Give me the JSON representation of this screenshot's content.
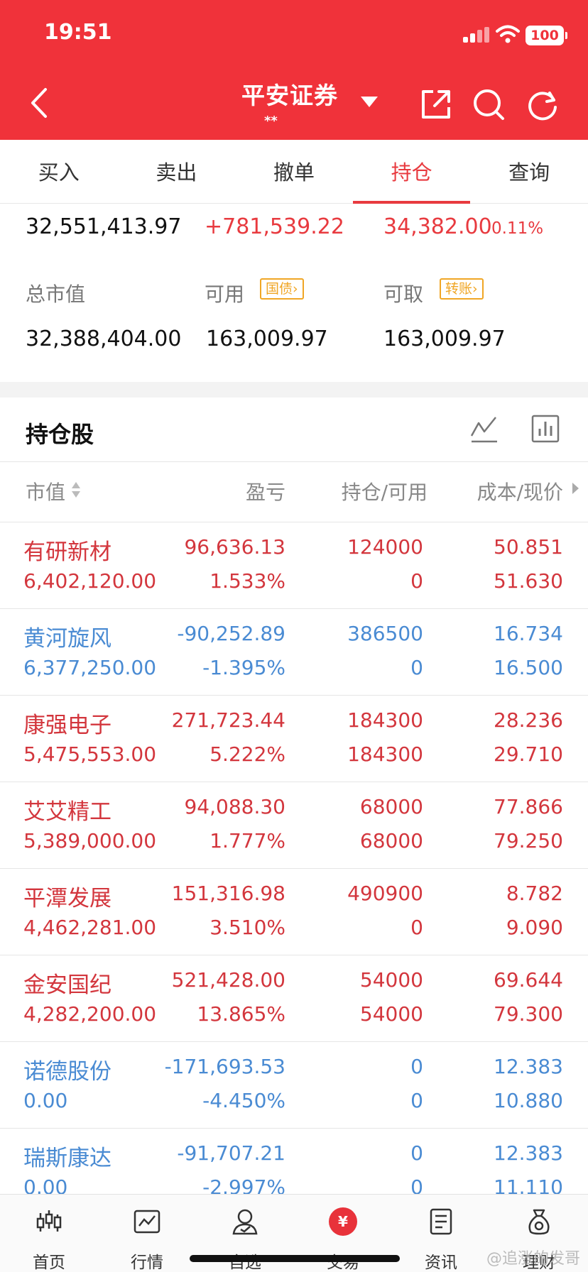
{
  "status": {
    "time": "19:51",
    "battery": "100"
  },
  "header": {
    "title": "平安证券",
    "subtitle": "**"
  },
  "tabs": [
    "买入",
    "卖出",
    "撤单",
    "持仓",
    "查询"
  ],
  "summary": {
    "total_asset": "32,551,413.97",
    "floating_pl": "+781,539.22",
    "today_pl": "34,382.00",
    "today_pl_pct": "0.11%",
    "market_value_label": "总市值",
    "market_value": "32,388,404.00",
    "available_label": "可用",
    "available_tag": "国债",
    "available": "163,009.97",
    "withdrawable_label": "可取",
    "withdrawable_tag": "转账",
    "withdrawable": "163,009.97"
  },
  "holdings": {
    "title": "持仓股",
    "columns": {
      "market_value": "市值",
      "pl": "盈亏",
      "position": "持仓/可用",
      "cost_price": "成本/现价"
    },
    "rows": [
      {
        "name": "有研新材",
        "market_value": "6,402,120.00",
        "pl": "96,636.13",
        "pl_pct": "1.533%",
        "position": "124000",
        "available": "0",
        "cost": "50.851",
        "price": "51.630",
        "trend": "up"
      },
      {
        "name": "黄河旋风",
        "market_value": "6,377,250.00",
        "pl": "-90,252.89",
        "pl_pct": "-1.395%",
        "position": "386500",
        "available": "0",
        "cost": "16.734",
        "price": "16.500",
        "trend": "down"
      },
      {
        "name": "康强电子",
        "market_value": "5,475,553.00",
        "pl": "271,723.44",
        "pl_pct": "5.222%",
        "position": "184300",
        "available": "184300",
        "cost": "28.236",
        "price": "29.710",
        "trend": "up"
      },
      {
        "name": "艾艾精工",
        "market_value": "5,389,000.00",
        "pl": "94,088.30",
        "pl_pct": "1.777%",
        "position": "68000",
        "available": "68000",
        "cost": "77.866",
        "price": "79.250",
        "trend": "up"
      },
      {
        "name": "平潭发展",
        "market_value": "4,462,281.00",
        "pl": "151,316.98",
        "pl_pct": "3.510%",
        "position": "490900",
        "available": "0",
        "cost": "8.782",
        "price": "9.090",
        "trend": "up"
      },
      {
        "name": "金安国纪",
        "market_value": "4,282,200.00",
        "pl": "521,428.00",
        "pl_pct": "13.865%",
        "position": "54000",
        "available": "54000",
        "cost": "69.644",
        "price": "79.300",
        "trend": "up"
      },
      {
        "name": "诺德股份",
        "market_value": "0.00",
        "pl": "-171,693.53",
        "pl_pct": "-4.450%",
        "position": "0",
        "available": "0",
        "cost": "12.383",
        "price": "10.880",
        "trend": "down"
      },
      {
        "name": "瑞斯康达",
        "market_value": "0.00",
        "pl": "-91,707.21",
        "pl_pct": "-2.997%",
        "position": "0",
        "available": "0",
        "cost": "12.383",
        "price": "11.110",
        "trend": "down"
      }
    ]
  },
  "nav": [
    {
      "label": "首页",
      "icon": "candlestick-icon"
    },
    {
      "label": "行情",
      "icon": "chart-icon"
    },
    {
      "label": "自选",
      "icon": "user-icon"
    },
    {
      "label": "交易",
      "icon": "yuan-icon",
      "glyph": "¥"
    },
    {
      "label": "资讯",
      "icon": "document-icon"
    },
    {
      "label": "理财",
      "icon": "money-bag-icon"
    }
  ],
  "watermark": "@追涨的发哥",
  "colors": {
    "header": "#f0323a",
    "up": "#d3363d",
    "down": "#4a8bd3",
    "tag": "#f0a625"
  }
}
